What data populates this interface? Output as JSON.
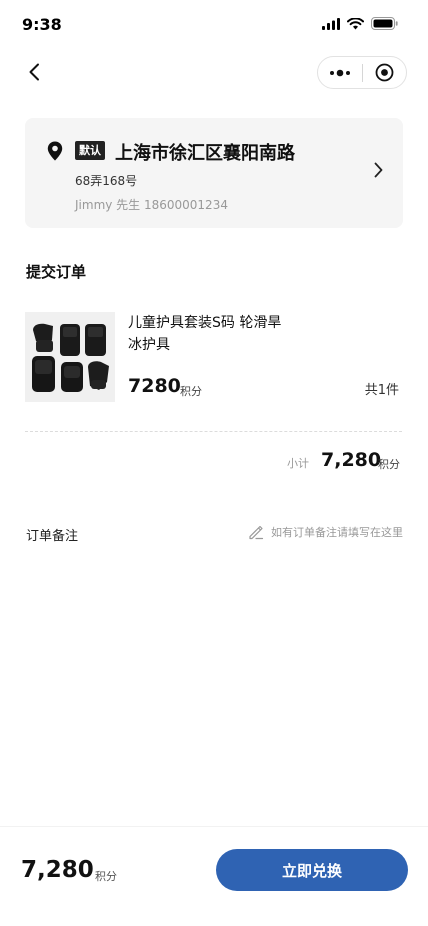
{
  "status_bar": {
    "time": "9:38"
  },
  "address": {
    "badge": "默认",
    "line1": "上海市徐汇区襄阳南路",
    "line2": "68弄168号",
    "contact": "Jimmy 先生 18600001234"
  },
  "order": {
    "section_title": "提交订单",
    "product": {
      "name": "儿童护具套装S码 轮滑旱冰护具",
      "price": "7280",
      "price_unit": "积分",
      "quantity": "共1件"
    },
    "subtotal": {
      "label": "小计",
      "value": "7,280",
      "unit": "积分"
    }
  },
  "remark": {
    "label": "订单备注",
    "placeholder": "如有订单备注请填写在这里"
  },
  "footer": {
    "total": "7,280",
    "unit": "积分",
    "button": "立即兑换",
    "button_color": "#2f63b3"
  }
}
